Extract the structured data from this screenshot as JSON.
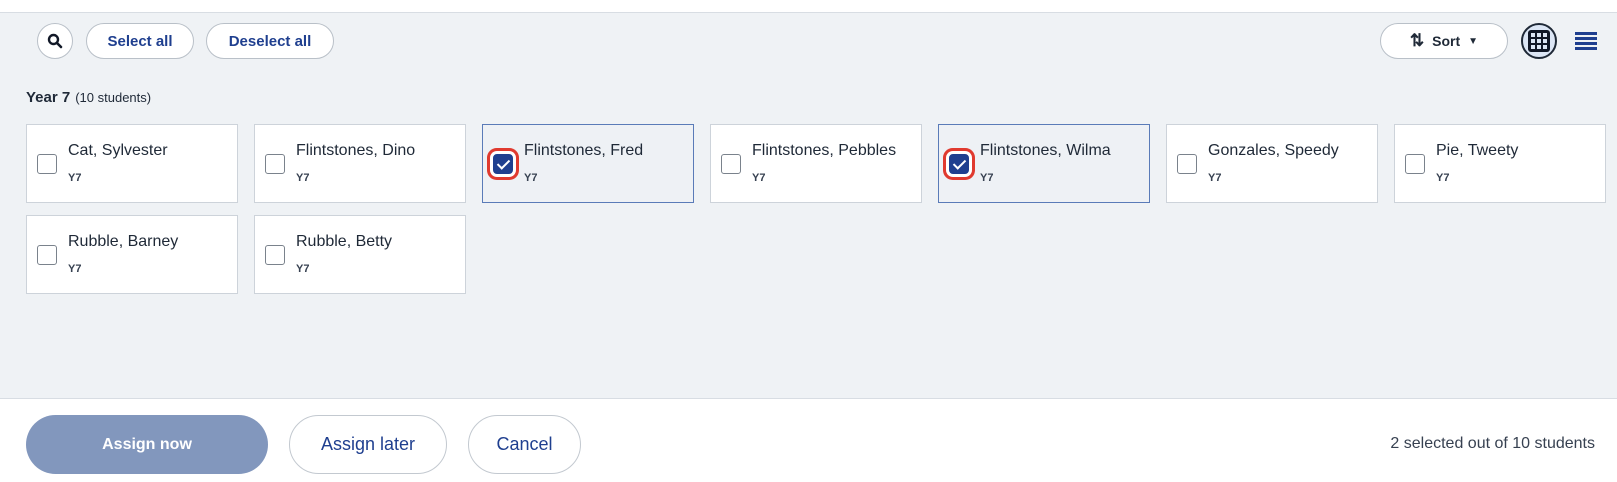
{
  "toolbar": {
    "select_all_label": "Select all",
    "deselect_all_label": "Deselect all",
    "sort_label": "Sort",
    "sort_arrows": "⇅",
    "sort_caret": "▼"
  },
  "group": {
    "title": "Year 7",
    "count_label": "(10 students)"
  },
  "students": [
    {
      "name": "Cat, Sylvester",
      "year": "Y7",
      "checked": false
    },
    {
      "name": "Flintstones, Dino",
      "year": "Y7",
      "checked": false
    },
    {
      "name": "Flintstones, Fred",
      "year": "Y7",
      "checked": true
    },
    {
      "name": "Flintstones, Pebbles",
      "year": "Y7",
      "checked": false
    },
    {
      "name": "Flintstones, Wilma",
      "year": "Y7",
      "checked": true
    },
    {
      "name": "Gonzales, Speedy",
      "year": "Y7",
      "checked": false
    },
    {
      "name": "Pie, Tweety",
      "year": "Y7",
      "checked": false
    },
    {
      "name": "Rubble, Barney",
      "year": "Y7",
      "checked": false
    },
    {
      "name": "Rubble, Betty",
      "year": "Y7",
      "checked": false
    }
  ],
  "footer": {
    "assign_now_label": "Assign now",
    "assign_later_label": "Assign later",
    "cancel_label": "Cancel",
    "status_text": "2 selected out of 10 students"
  },
  "colors": {
    "accent": "#1f3f8f",
    "highlight_ring": "#e03a2f",
    "assign_now_bg": "#8297bd"
  },
  "icons": {
    "search": "search-icon",
    "grid_view": "grid-view-icon",
    "list_view": "list-view-icon",
    "sort": "sort-icon"
  }
}
